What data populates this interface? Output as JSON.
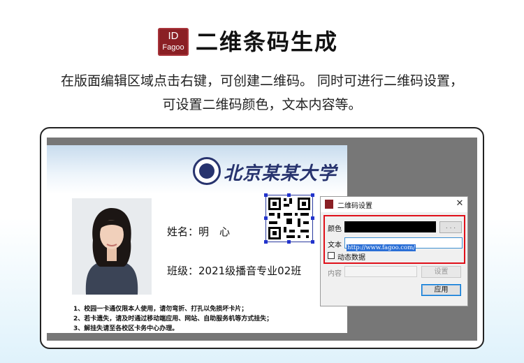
{
  "header": {
    "logo_line1": "ID",
    "logo_line2": "Fagoo",
    "title": "二维条码生成"
  },
  "description": {
    "line1": "在版面编辑区域点击右键，可创建二维码。 同时可进行二维码设置，",
    "line2": "可设置二维码颜色，文本内容等。"
  },
  "card": {
    "university": "北京某某大学",
    "name_label": "姓名：明　心",
    "class_label": "班级：2021级播音专业02班",
    "notes": [
      "1、校园一卡通仅限本人使用，请勿弯折、打孔以免损坏卡片；",
      "2、若卡遗失，请及时通过移动端应用、网站、自助服务机等方式挂失；",
      "3、解挂失请至各校区卡务中心办理。"
    ]
  },
  "dialog": {
    "title": "二维码设置",
    "close": "✕",
    "color_label": "颜色",
    "color_value": "#000000",
    "dots_button": ". . .",
    "text_label": "文本",
    "text_value": "http://www.fagoo.com/",
    "dynamic_label": "动态数据",
    "dynamic_checked": false,
    "content_label": "内容",
    "set_button": "设置",
    "apply_button": "应用"
  },
  "colors": {
    "brand": "#8a1f24",
    "highlight": "#e0101a",
    "university": "#27336e"
  }
}
